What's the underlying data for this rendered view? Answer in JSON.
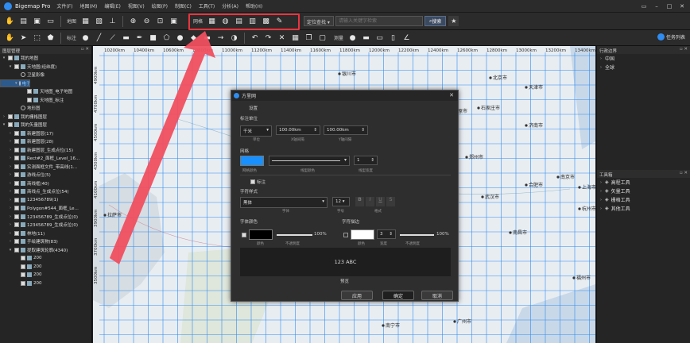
{
  "app": {
    "name": "Bigemap Pro",
    "menus": [
      "文件(F)",
      "地图(M)",
      "编辑(E)",
      "视图(V)",
      "绘图(P)",
      "制图(C)",
      "工具(T)",
      "分析(A)",
      "帮助(H)"
    ]
  },
  "toolbar1": {
    "map_label": "地图",
    "grid_label": "网格",
    "search_type": "定位查找",
    "search_placeholder": "请输入关键字检索",
    "search_button": "搜索"
  },
  "toolbar2": {
    "label_label": "标注",
    "measure_label": "测量",
    "task_list": "任务列表"
  },
  "left_panel": {
    "title": "图层管理",
    "items": [
      {
        "label": "我的地图",
        "level": 0,
        "exp": "▾",
        "cb": true
      },
      {
        "label": "天地图(经纬度)",
        "level": 1,
        "exp": "▾",
        "cb": true
      },
      {
        "label": "卫星影像",
        "level": 2,
        "exp": "",
        "radio": true
      },
      {
        "label": "电子地图",
        "level": 2,
        "exp": "▾",
        "radio": true,
        "selected": true
      },
      {
        "label": "天地图_电子地图",
        "level": 3,
        "exp": "",
        "cb": true
      },
      {
        "label": "天地图_标注",
        "level": 3,
        "exp": "",
        "cb": true
      },
      {
        "label": "地形图",
        "level": 2,
        "exp": "",
        "radio": true
      },
      {
        "label": "我的栅格图层",
        "level": 0,
        "exp": "›",
        "cb": true
      },
      {
        "label": "我的矢量图层",
        "level": 0,
        "exp": "▾",
        "cb": true
      },
      {
        "label": "新建图层(17)",
        "level": 1,
        "exp": "›",
        "cb": true
      },
      {
        "label": "新建图层(28)",
        "level": 1,
        "exp": "›",
        "cb": true
      },
      {
        "label": "新建图层_生成点位(15)",
        "level": 1,
        "exp": "›",
        "cb": true
      },
      {
        "label": "Rect#2_面框_Level_16...",
        "level": 1,
        "exp": "›",
        "cb": true
      },
      {
        "label": "实测面框文件_带高线(1...",
        "level": 1,
        "exp": "›",
        "cb": true
      },
      {
        "label": "游线点位(5)",
        "level": 1,
        "exp": "›",
        "cb": true
      },
      {
        "label": "商线框(40)",
        "level": 1,
        "exp": "›",
        "cb": true
      },
      {
        "label": "商线点_生成点位(54)",
        "level": 1,
        "exp": "›",
        "cb": true
      },
      {
        "label": "123456789(1)",
        "level": 1,
        "exp": "›",
        "cb": true
      },
      {
        "label": "Polygon#544_面框_Le...",
        "level": 1,
        "exp": "›",
        "cb": true
      },
      {
        "label": "123456789_生成点位(0)",
        "level": 1,
        "exp": "›",
        "cb": true
      },
      {
        "label": "123456789_生成点位(0)",
        "level": 1,
        "exp": "›",
        "cb": true
      },
      {
        "label": "林地(11)",
        "level": 1,
        "exp": "›",
        "cb": true
      },
      {
        "label": "手绘建筑物(83)",
        "level": 1,
        "exp": "›",
        "cb": true
      },
      {
        "label": "提取建筑轮廓(4340)",
        "level": 1,
        "exp": "▾",
        "cb": true
      },
      {
        "label": "200",
        "level": 2,
        "exp": "",
        "cb": true
      },
      {
        "label": "200",
        "level": 2,
        "exp": "",
        "cb": true
      },
      {
        "label": "200",
        "level": 2,
        "exp": "",
        "cb": true
      },
      {
        "label": "200",
        "level": 2,
        "exp": "",
        "cb": true
      }
    ]
  },
  "map": {
    "x_ticks": [
      "10200km",
      "10400km",
      "10600km",
      "10800km",
      "11000km",
      "11200km",
      "11400km",
      "11600km",
      "11800km",
      "12000km",
      "12200km",
      "12400km",
      "12600km",
      "12800km",
      "13000km",
      "13200km",
      "13400km"
    ],
    "y_ticks": [
      "4900km",
      "4700km",
      "4500km",
      "4300km",
      "4100km",
      "3900km",
      "3700km",
      "3500km"
    ],
    "cities": [
      {
        "name": "银川市",
        "x": 310,
        "y": 35
      },
      {
        "name": "北京市",
        "x": 500,
        "y": 40
      },
      {
        "name": "天津市",
        "x": 545,
        "y": 52
      },
      {
        "name": "石家庄市",
        "x": 485,
        "y": 78
      },
      {
        "name": "太原市",
        "x": 450,
        "y": 82
      },
      {
        "name": "济南市",
        "x": 545,
        "y": 100
      },
      {
        "name": "西宁市",
        "x": 175,
        "y": 82
      },
      {
        "name": "兰州市",
        "x": 225,
        "y": 95
      },
      {
        "name": "郑州市",
        "x": 470,
        "y": 140
      },
      {
        "name": "合肥市",
        "x": 545,
        "y": 175
      },
      {
        "name": "南京市",
        "x": 585,
        "y": 165
      },
      {
        "name": "上海市",
        "x": 612,
        "y": 178
      },
      {
        "name": "杭州市",
        "x": 612,
        "y": 205
      },
      {
        "name": "武汉市",
        "x": 490,
        "y": 190
      },
      {
        "name": "南昌市",
        "x": 525,
        "y": 235
      },
      {
        "name": "拉萨市",
        "x": 15,
        "y": 213
      },
      {
        "name": "广州市",
        "x": 455,
        "y": 347
      },
      {
        "name": "南宁市",
        "x": 365,
        "y": 352
      },
      {
        "name": "福州市",
        "x": 605,
        "y": 292
      }
    ]
  },
  "right_panel": {
    "title": "行政边界",
    "boundaries": [
      "中国",
      "全球"
    ],
    "tools_title": "工具箱",
    "tools": [
      "高程工具",
      "矢量工具",
      "栅格工具",
      "其他工具"
    ]
  },
  "dialog": {
    "title": "方里网",
    "settings": "设置",
    "unit_label": "标注单位",
    "unit_value": "千米",
    "unit_sub": "单位",
    "x_spacing": "100.00km",
    "x_spacing_sub": "X轴间隔",
    "y_spacing": "100.00km",
    "y_spacing_sub": "Y轴间隔",
    "grid_label": "网格",
    "grid_color_sub": "网格颜色",
    "line_style_sub": "线型颜色",
    "line_width": "1",
    "line_width_sub": "线型宽度",
    "annotate": "标注",
    "font_style": "字符样式",
    "font_name": "黑体",
    "font_name_sub": "字体",
    "font_size": "12",
    "font_size_sub": "字号",
    "format_sub": "格式",
    "font_color": "字体颜色",
    "font_color_sub": "颜色",
    "opacity_sub": "不透明度",
    "opacity_value": "100%",
    "outline": "字符描边",
    "outline_color_sub": "颜色",
    "outline_width": "3",
    "outline_width_sub": "宽度",
    "outline_opacity_value": "100%",
    "preview_text": "123 ABC",
    "preview_label": "预览",
    "apply": "应用",
    "ok": "确定",
    "cancel": "取消"
  },
  "colors": {
    "accent": "#2f8cf0",
    "highlight": "#e8353f",
    "grid": "#2f8cf0"
  }
}
